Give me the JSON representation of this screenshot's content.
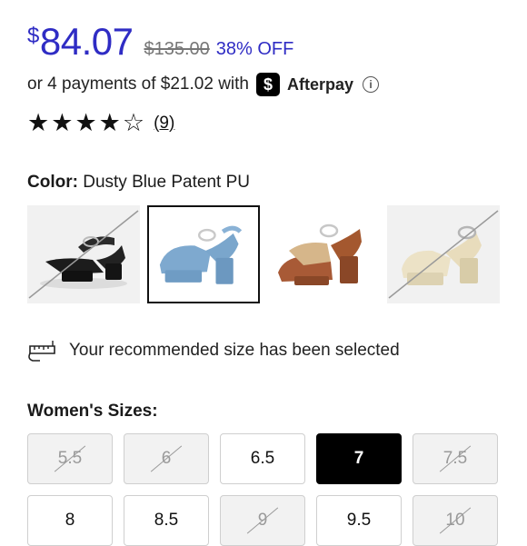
{
  "price": {
    "currency": "$",
    "current": "84.07",
    "original": "$135.00",
    "discount": "38% OFF"
  },
  "afterpay": {
    "text": "or 4 payments of $21.02 with",
    "logo_glyph": "$",
    "brand": "Afterpay",
    "info_icon": "i"
  },
  "rating": {
    "stars": 4,
    "max": 5,
    "reviews": "(9)"
  },
  "color": {
    "label": "Color:",
    "value": "Dusty Blue Patent PU",
    "swatches": [
      {
        "name": "black",
        "selected": false,
        "unavailable": true
      },
      {
        "name": "dusty-blue",
        "selected": true,
        "unavailable": false
      },
      {
        "name": "cognac-raffia",
        "selected": false,
        "unavailable": false
      },
      {
        "name": "cream",
        "selected": false,
        "unavailable": true
      }
    ]
  },
  "size_note": "Your recommended size has been selected",
  "sizes_title": "Women's Sizes:",
  "sizes": [
    {
      "label": "5.5",
      "state": "unavailable"
    },
    {
      "label": "6",
      "state": "unavailable"
    },
    {
      "label": "6.5",
      "state": "available"
    },
    {
      "label": "7",
      "state": "selected"
    },
    {
      "label": "7.5",
      "state": "unavailable"
    },
    {
      "label": "8",
      "state": "available"
    },
    {
      "label": "8.5",
      "state": "available"
    },
    {
      "label": "9",
      "state": "unavailable"
    },
    {
      "label": "9.5",
      "state": "available"
    },
    {
      "label": "10",
      "state": "unavailable"
    }
  ],
  "colors": {
    "accent": "#2f2cc4",
    "selected_bg": "#000000"
  }
}
